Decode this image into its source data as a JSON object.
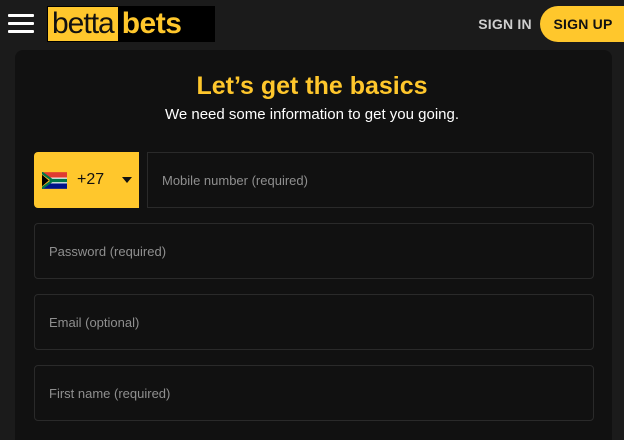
{
  "header": {
    "menu_icon": "hamburger-menu-icon",
    "logo_part1": "betta",
    "logo_part2": "bets",
    "sign_in_label": "SIGN IN",
    "sign_up_label": "SIGN UP"
  },
  "form": {
    "title": "Let’s get the basics",
    "subtitle": "We need some information to get you going.",
    "country": {
      "flag_icon": "south-africa-flag-icon",
      "dial_code": "+27",
      "dropdown_icon": "caret-down-icon"
    },
    "mobile_placeholder": "Mobile number (required)",
    "password_placeholder": "Password (required)",
    "email_placeholder": "Email (optional)",
    "firstname_placeholder": "First name (required)"
  },
  "colors": {
    "accent": "#ffc72c",
    "background": "#111111",
    "topbar": "#1b1b1b"
  }
}
